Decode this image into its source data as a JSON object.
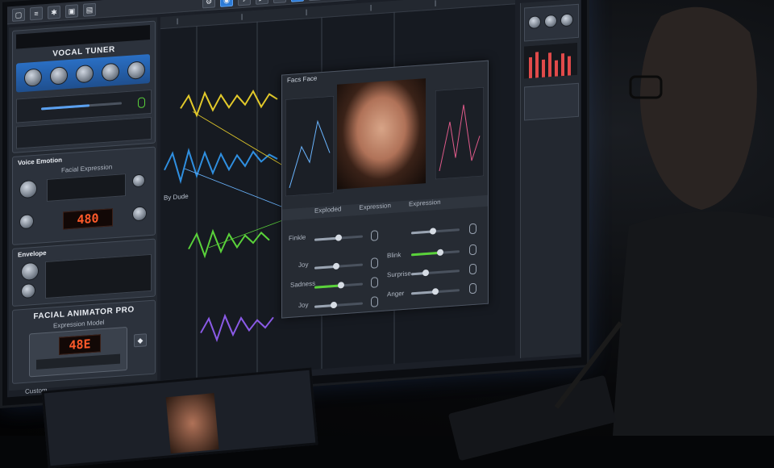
{
  "left_panel": {
    "vocal_tuner": {
      "title": "VOCAL TUNER"
    },
    "module2": {
      "title": "Voice Emotion",
      "subtitle": "Facial Expression",
      "display": "480"
    },
    "module3": {
      "title": "Envelope"
    },
    "facial_animator": {
      "title": "FACIAL ANIMATOR PRO",
      "subtitle": "Expression Model",
      "display": "48E"
    },
    "footer": {
      "label": "Custom"
    }
  },
  "timeline": {
    "track_label": "By Dude"
  },
  "face_panel": {
    "title": "Facs Face",
    "tabs": [
      "Exploded",
      "Expression",
      "Expression"
    ],
    "sliders_left": [
      {
        "label": "Finkle",
        "value": 0.5
      },
      {
        "label": "Joy",
        "value": 0.45
      },
      {
        "label": "Sadness",
        "value": 0.55
      },
      {
        "label": "Joy",
        "value": 0.4
      }
    ],
    "sliders_right": [
      {
        "label": "",
        "value": 0.45
      },
      {
        "label": "Blink",
        "value": 0.6
      },
      {
        "label": "Surprise",
        "value": 0.3
      },
      {
        "label": "Anger",
        "value": 0.5
      }
    ]
  },
  "colors": {
    "accent": "#2d7bd6",
    "wave_yellow": "#e2c92a",
    "wave_blue": "#2f8fe0",
    "wave_green": "#5ad23a",
    "wave_purple": "#8a5ae6",
    "lcd": "#ff5a2a"
  }
}
